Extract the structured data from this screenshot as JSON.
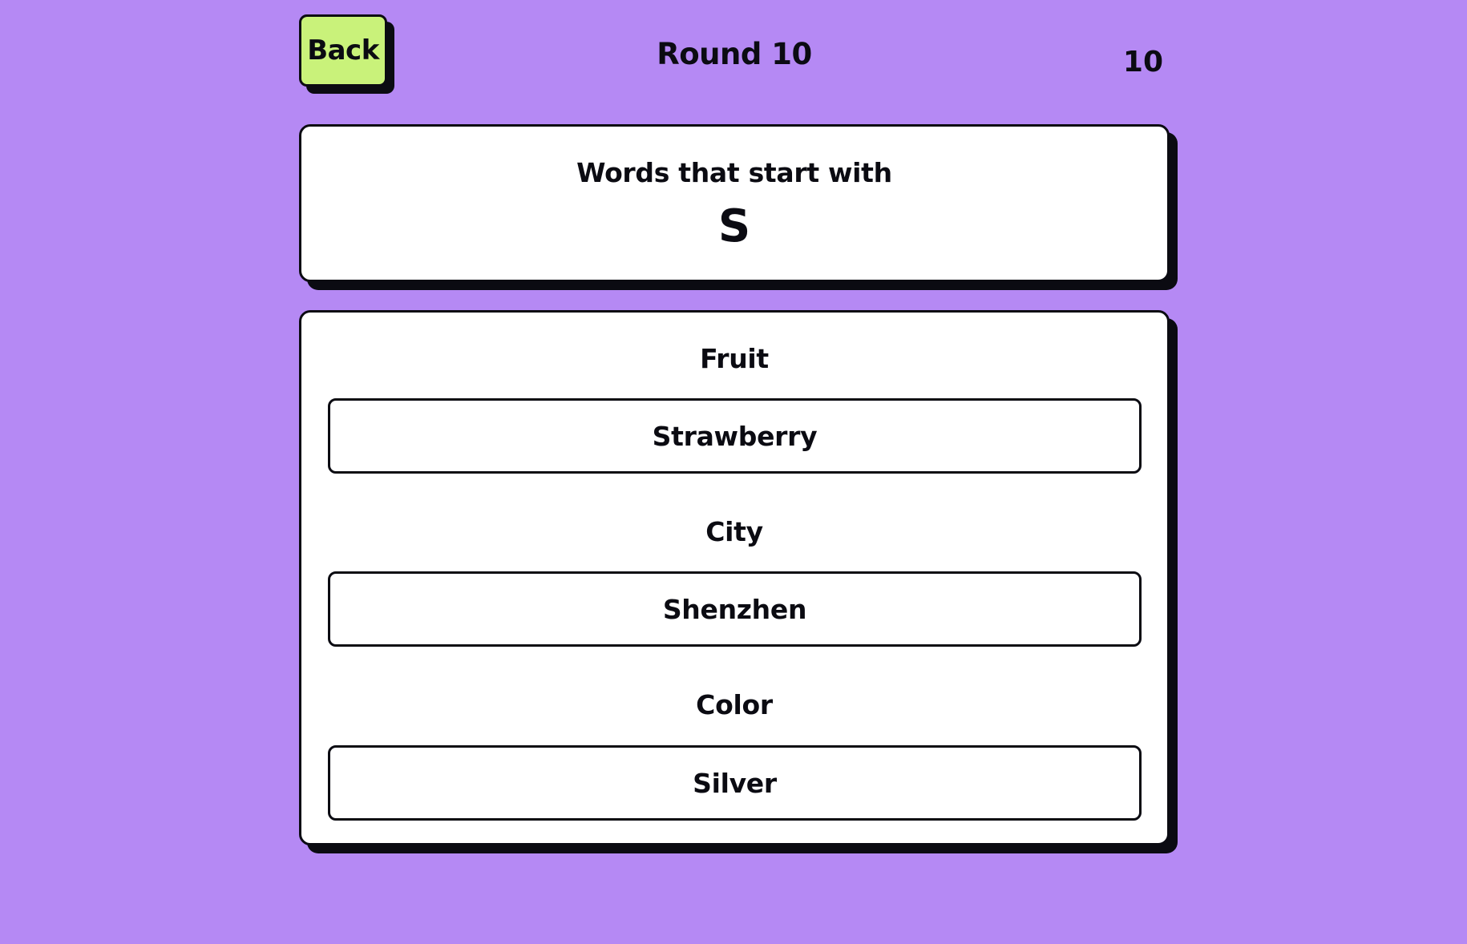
{
  "header": {
    "back_label": "Back",
    "round_title": "Round 10",
    "score": "10"
  },
  "prompt": {
    "text": "Words that start with",
    "letter": "S"
  },
  "answers": [
    {
      "category": "Fruit",
      "value": "Strawberry"
    },
    {
      "category": "City",
      "value": "Shenzhen"
    },
    {
      "category": "Color",
      "value": "Silver"
    }
  ],
  "colors": {
    "background": "#b589f4",
    "back_button": "#c9f27a",
    "card": "#ffffff",
    "ink": "#0b0b12"
  }
}
